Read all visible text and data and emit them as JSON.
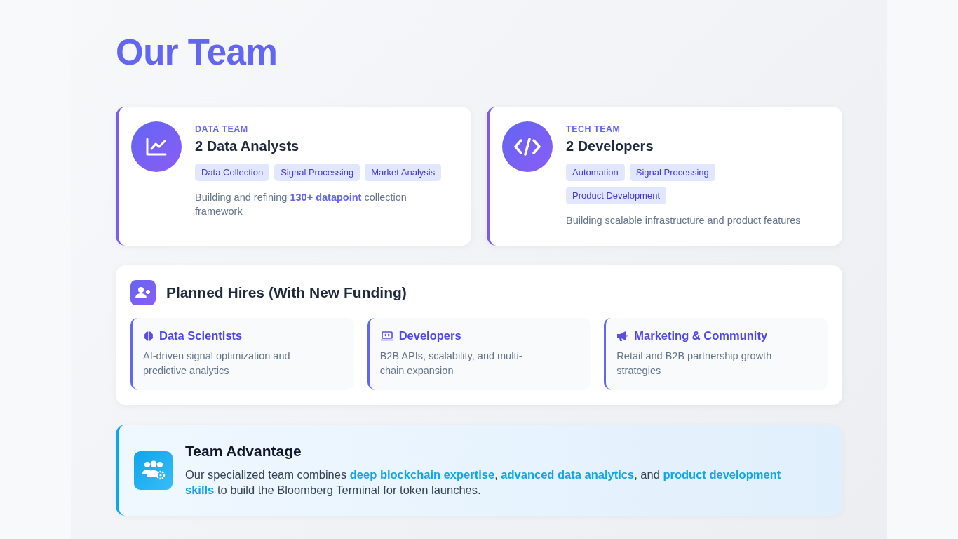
{
  "title": "Our Team",
  "teams": [
    {
      "kicker": "DATA TEAM",
      "heading": "2 Data Analysts",
      "tags": [
        "Data Collection",
        "Signal Processing",
        "Market Analysis"
      ],
      "description": "Building and refining **130+ datapoint** collection framework"
    },
    {
      "kicker": "TECH TEAM",
      "heading": "2 Developers",
      "tags": [
        "Automation",
        "Signal Processing",
        "Product Development"
      ],
      "description": "Building scalable infrastructure and product features"
    }
  ],
  "planned_hires": {
    "title": "Planned Hires (With New Funding)",
    "roles": [
      {
        "title": "Data Scientists",
        "description": "AI-driven signal optimization and predictive analytics"
      },
      {
        "title": "Developers",
        "description": "B2B APIs, scalability, and multi-chain expansion"
      },
      {
        "title": "Marketing & Community",
        "description": "Retail and B2B partnership growth strategies"
      }
    ]
  },
  "advantage": {
    "title": "Team Advantage",
    "text": "Our specialized team combines **deep blockchain expertise**, **advanced data analytics**, and **product development skills** to build the Bloomberg Terminal for token launches."
  }
}
